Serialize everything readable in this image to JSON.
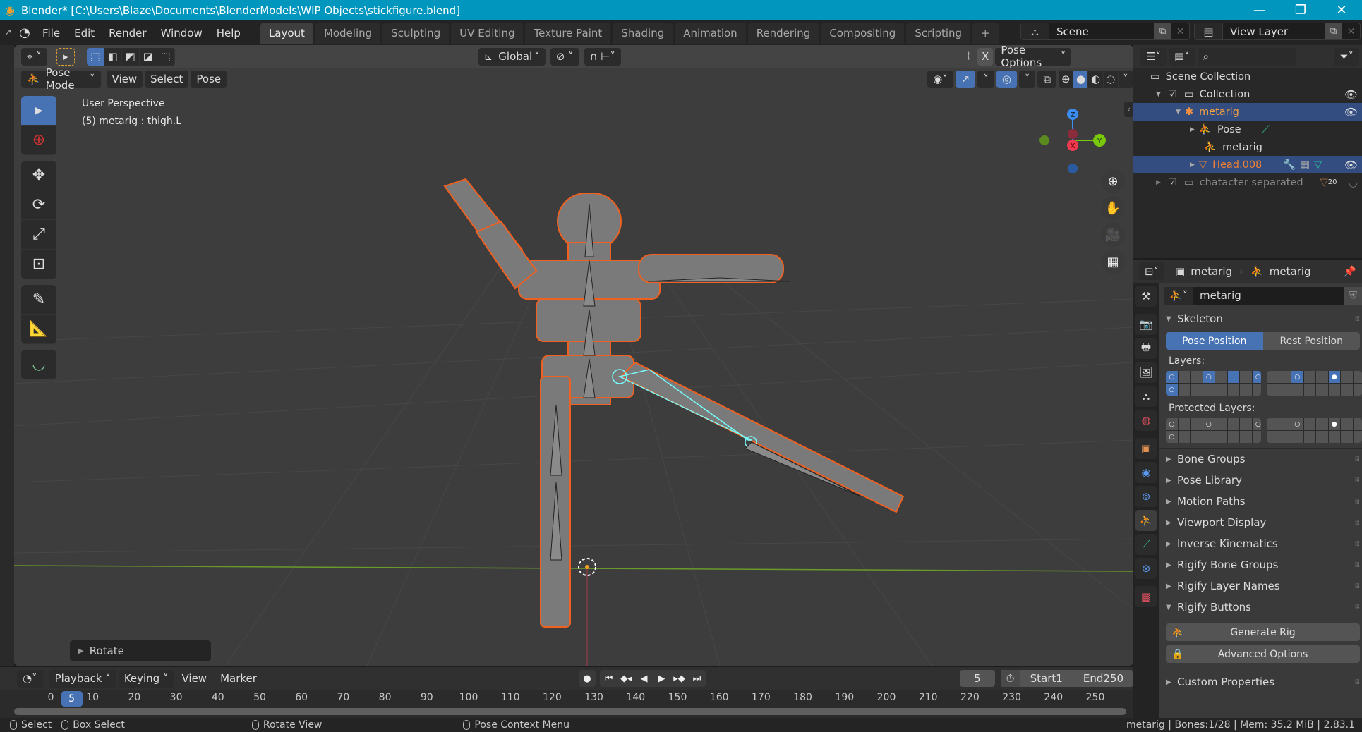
{
  "window": {
    "title": "Blender* [C:\\Users\\Blaze\\Documents\\BlenderModels\\WIP Objects\\stickfigure.blend]",
    "minimize": "—",
    "maximize": "❐",
    "close": "✕"
  },
  "menubar": {
    "items": [
      "File",
      "Edit",
      "Render",
      "Window",
      "Help"
    ]
  },
  "workspaces": {
    "tabs": [
      "Layout",
      "Modeling",
      "Sculpting",
      "UV Editing",
      "Texture Paint",
      "Shading",
      "Animation",
      "Rendering",
      "Compositing",
      "Scripting"
    ],
    "active": "Layout",
    "add": "+"
  },
  "scene": {
    "label": "Scene"
  },
  "view_layer": {
    "label": "View Layer"
  },
  "viewport": {
    "transform_orientation": "Global",
    "pose_options": "Pose Options",
    "mode": "Pose Mode",
    "menus": [
      "View",
      "Select",
      "Pose"
    ],
    "overlay_title": "User Perspective",
    "overlay_subtitle": "(5) metarig : thigh.L",
    "gizmo": {
      "x": "X",
      "y": "Y",
      "z": "Z"
    },
    "x_mirror": "X",
    "last_op_panel": "Rotate"
  },
  "outliner": {
    "rows": [
      {
        "label": "Scene Collection"
      },
      {
        "label": "Collection"
      },
      {
        "label": "metarig"
      },
      {
        "label": "Pose"
      },
      {
        "label": "metarig"
      },
      {
        "label": "Head.008"
      },
      {
        "label": "chatacter separated",
        "badge": "20"
      }
    ]
  },
  "properties": {
    "breadcrumb": [
      "metarig",
      "metarig"
    ],
    "datablock": "metarig",
    "skeleton": {
      "title": "Skeleton",
      "pose_position": "Pose Position",
      "rest_position": "Rest Position",
      "active_position": "Pose Position",
      "layers_label": "Layers:",
      "protected_layers_label": "Protected Layers:"
    },
    "panels": [
      "Bone Groups",
      "Pose Library",
      "Motion Paths",
      "Viewport Display",
      "Inverse Kinematics",
      "Rigify Bone Groups",
      "Rigify Layer Names",
      "Rigify Buttons"
    ],
    "generate_rig": "Generate Rig",
    "advanced_options": "Advanced Options",
    "custom_properties": "Custom Properties"
  },
  "timeline": {
    "menus": [
      "Playback",
      "Keying",
      "View",
      "Marker"
    ],
    "current_frame": "5",
    "start_label": "Start",
    "start": "1",
    "end_label": "End",
    "end": "250",
    "ticks": [
      "0",
      "10",
      "20",
      "30",
      "40",
      "50",
      "60",
      "70",
      "80",
      "90",
      "100",
      "110",
      "120",
      "130",
      "140",
      "150",
      "160",
      "170",
      "180",
      "190",
      "200",
      "210",
      "220",
      "230",
      "240",
      "250"
    ]
  },
  "statusbar": {
    "select": "Select",
    "box_select": "Box Select",
    "rotate_view": "Rotate View",
    "context_menu": "Pose Context Menu",
    "info": "metarig | Bones:1/28  | Mem: 35.2 MiB | 2.83.1"
  }
}
